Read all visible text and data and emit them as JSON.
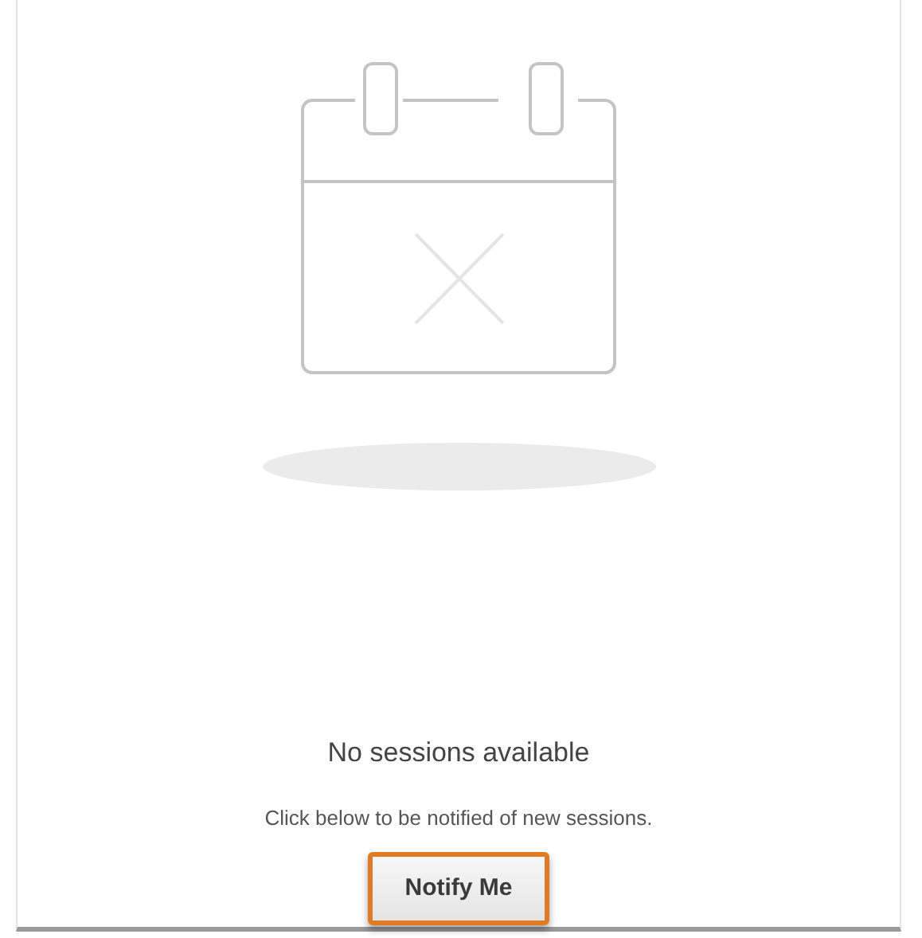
{
  "empty_state": {
    "title": "No sessions available",
    "message": "Click below to be notified of new sessions.",
    "button": "Notify Me",
    "button_focused": true
  }
}
